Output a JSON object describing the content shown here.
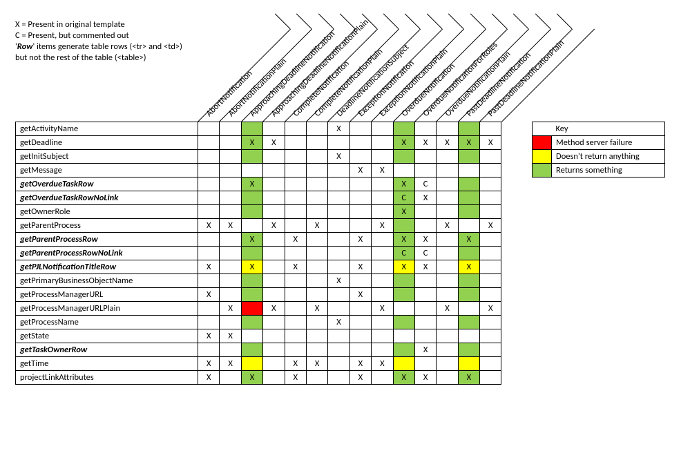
{
  "legend": {
    "line1": "X = Present in original template",
    "line2": "C = Present, but commented out",
    "line3a": "'",
    "line3b": "Row",
    "line3c": "' items generate table rows (<tr> and <td>) but not the rest of the table (<table>)"
  },
  "columns": [
    "AbortNotification",
    "AbortNotificationPlain",
    "ApproachingDeadlineNotification",
    "ApproachingDeadlineNotificationPlain",
    "CompleteNotification",
    "CompleteNotificationPlain",
    "DeadlineNotificationSubject",
    "ExceptionNotification",
    "ExceptionNotificationPlain",
    "OverdueNotification",
    "OverdueNotificationForRoles",
    "OverdueNotificationPlain",
    "PastDeadlineNotification",
    "PastDeadlineNotificationPlain"
  ],
  "rows": [
    {
      "label": "getActivityName",
      "bold": false,
      "cells": [
        "",
        "",
        "G",
        "",
        "",
        "",
        "X",
        "",
        "",
        "G",
        "",
        "",
        "G",
        ""
      ]
    },
    {
      "label": "getDeadline",
      "bold": false,
      "cells": [
        "",
        "",
        "GX",
        "X",
        "",
        "",
        "",
        "",
        "",
        "GX",
        "X",
        "X",
        "GX",
        "X"
      ]
    },
    {
      "label": "getInitSubject",
      "bold": false,
      "cells": [
        "",
        "",
        "G",
        "",
        "",
        "",
        "X",
        "",
        "",
        "G",
        "",
        "",
        "G",
        ""
      ]
    },
    {
      "label": "getMessage",
      "bold": false,
      "cells": [
        "",
        "",
        "",
        "",
        "",
        "",
        "",
        "X",
        "X",
        "",
        "",
        "",
        "",
        ""
      ]
    },
    {
      "label": "getOverdueTaskRow",
      "bold": true,
      "cells": [
        "",
        "",
        "GX",
        "",
        "",
        "",
        "",
        "",
        "",
        "GX",
        "C",
        "",
        "G",
        ""
      ]
    },
    {
      "label": "getOverdueTaskRowNoLink",
      "bold": true,
      "cells": [
        "",
        "",
        "G",
        "",
        "",
        "",
        "",
        "",
        "",
        "GC",
        "X",
        "",
        "G",
        ""
      ]
    },
    {
      "label": "getOwnerRole",
      "bold": false,
      "cells": [
        "",
        "",
        "G",
        "",
        "",
        "",
        "",
        "",
        "",
        "GX",
        "",
        "",
        "G",
        ""
      ]
    },
    {
      "label": "getParentProcess",
      "bold": false,
      "cells": [
        "X",
        "X",
        "",
        "X",
        "",
        "X",
        "",
        "",
        "X",
        "G",
        "",
        "X",
        "",
        "X"
      ]
    },
    {
      "label": "getParentProcessRow",
      "bold": true,
      "cells": [
        "",
        "",
        "GX",
        "",
        "X",
        "",
        "",
        "X",
        "",
        "GX",
        "X",
        "",
        "GX",
        ""
      ]
    },
    {
      "label": "getParentProcessRowNoLink",
      "bold": true,
      "cells": [
        "",
        "",
        "G",
        "",
        "",
        "",
        "",
        "",
        "",
        "GC",
        "C",
        "",
        "G",
        ""
      ]
    },
    {
      "label": "getPJLNotificationTitleRow",
      "bold": true,
      "cells": [
        "X",
        "",
        "YX",
        "",
        "X",
        "",
        "",
        "X",
        "",
        "YX",
        "X",
        "",
        "YX",
        ""
      ]
    },
    {
      "label": "getPrimaryBusinessObjectName",
      "bold": false,
      "cells": [
        "",
        "",
        "G",
        "",
        "",
        "",
        "X",
        "",
        "",
        "G",
        "",
        "",
        "G",
        ""
      ]
    },
    {
      "label": "getProcessManagerURL",
      "bold": false,
      "cells": [
        "X",
        "",
        "G",
        "",
        "",
        "",
        "",
        "X",
        "",
        "G",
        "",
        "",
        "G",
        ""
      ]
    },
    {
      "label": "getProcessManagerURLPlain",
      "bold": false,
      "cells": [
        "",
        "X",
        "R",
        "X",
        "",
        "X",
        "",
        "",
        "X",
        "",
        "",
        "X",
        "",
        "X"
      ]
    },
    {
      "label": "getProcessName",
      "bold": false,
      "cells": [
        "",
        "",
        "G",
        "",
        "",
        "",
        "X",
        "",
        "",
        "G",
        "",
        "",
        "G",
        ""
      ]
    },
    {
      "label": "getState",
      "bold": false,
      "cells": [
        "X",
        "X",
        "",
        "",
        "",
        "",
        "",
        "",
        "",
        "",
        "",
        "",
        "",
        ""
      ]
    },
    {
      "label": "getTaskOwnerRow",
      "bold": true,
      "cells": [
        "",
        "",
        "G",
        "",
        "",
        "",
        "",
        "",
        "",
        "G",
        "X",
        "",
        "G",
        ""
      ]
    },
    {
      "label": "getTime",
      "bold": false,
      "cells": [
        "X",
        "X",
        "Y",
        "",
        "X",
        "X",
        "",
        "X",
        "X",
        "Y",
        "",
        "",
        "Y",
        ""
      ]
    },
    {
      "label": "projectLinkAttributes",
      "bold": false,
      "cells": [
        "X",
        "",
        "GX",
        "",
        "X",
        "",
        "",
        "X",
        "",
        "GX",
        "X",
        "",
        "GX",
        ""
      ]
    }
  ],
  "key": {
    "title": "Key",
    "items": [
      {
        "color": "red",
        "label": "Method server failure"
      },
      {
        "color": "yellow",
        "label": "Doesn't return anything"
      },
      {
        "color": "green",
        "label": "Returns something"
      }
    ]
  },
  "chart_data": {
    "type": "table",
    "note": "Matrix of template-method calls vs notification types. Cell background color = method return behavior; text X/C = presence in template.",
    "columns": [
      "AbortNotification",
      "AbortNotificationPlain",
      "ApproachingDeadlineNotification",
      "ApproachingDeadlineNotificationPlain",
      "CompleteNotification",
      "CompleteNotificationPlain",
      "DeadlineNotificationSubject",
      "ExceptionNotification",
      "ExceptionNotificationPlain",
      "OverdueNotification",
      "OverdueNotificationForRoles",
      "OverdueNotificationPlain",
      "PastDeadlineNotification",
      "PastDeadlineNotificationPlain"
    ],
    "row_labels": [
      "getActivityName",
      "getDeadline",
      "getInitSubject",
      "getMessage",
      "getOverdueTaskRow",
      "getOverdueTaskRowNoLink",
      "getOwnerRole",
      "getParentProcess",
      "getParentProcessRow",
      "getParentProcessRowNoLink",
      "getPJLNotificationTitleRow",
      "getPrimaryBusinessObjectName",
      "getProcessManagerURL",
      "getProcessManagerURLPlain",
      "getProcessName",
      "getState",
      "getTaskOwnerRow",
      "getTime",
      "projectLinkAttributes"
    ],
    "color_legend": {
      "red": "Method server failure",
      "yellow": "Doesn't return anything",
      "green": "Returns something"
    },
    "mark_legend": {
      "X": "Present in original template",
      "C": "Present, but commented out"
    },
    "cells_encoding": "Each cell string may contain leading color letter G/Y/R followed by optional mark X or C; empty = blank white cell.",
    "cells": [
      [
        "",
        "",
        "G",
        "",
        "",
        "",
        "X",
        "",
        "",
        "G",
        "",
        "",
        "G",
        ""
      ],
      [
        "",
        "",
        "GX",
        "X",
        "",
        "",
        "",
        "",
        "",
        "GX",
        "X",
        "X",
        "GX",
        "X"
      ],
      [
        "",
        "",
        "G",
        "",
        "",
        "",
        "X",
        "",
        "",
        "G",
        "",
        "",
        "G",
        ""
      ],
      [
        "",
        "",
        "",
        "",
        "",
        "",
        "",
        "X",
        "X",
        "",
        "",
        "",
        "",
        ""
      ],
      [
        "",
        "",
        "GX",
        "",
        "",
        "",
        "",
        "",
        "",
        "GX",
        "C",
        "",
        "G",
        ""
      ],
      [
        "",
        "",
        "G",
        "",
        "",
        "",
        "",
        "",
        "",
        "GC",
        "X",
        "",
        "G",
        ""
      ],
      [
        "",
        "",
        "G",
        "",
        "",
        "",
        "",
        "",
        "",
        "GX",
        "",
        "",
        "G",
        ""
      ],
      [
        "X",
        "X",
        "",
        "X",
        "",
        "X",
        "",
        "",
        "X",
        "G",
        "",
        "X",
        "",
        "X"
      ],
      [
        "",
        "",
        "GX",
        "",
        "X",
        "",
        "",
        "X",
        "",
        "GX",
        "X",
        "",
        "GX",
        ""
      ],
      [
        "",
        "",
        "G",
        "",
        "",
        "",
        "",
        "",
        "",
        "GC",
        "C",
        "",
        "G",
        ""
      ],
      [
        "X",
        "",
        "YX",
        "",
        "X",
        "",
        "",
        "X",
        "",
        "YX",
        "X",
        "",
        "YX",
        ""
      ],
      [
        "",
        "",
        "G",
        "",
        "",
        "",
        "X",
        "",
        "",
        "G",
        "",
        "",
        "G",
        ""
      ],
      [
        "X",
        "",
        "G",
        "",
        "",
        "",
        "",
        "X",
        "",
        "G",
        "",
        "",
        "G",
        ""
      ],
      [
        "",
        "X",
        "R",
        "X",
        "",
        "X",
        "",
        "",
        "X",
        "",
        "",
        "X",
        "",
        "X"
      ],
      [
        "",
        "",
        "G",
        "",
        "",
        "",
        "X",
        "",
        "",
        "G",
        "",
        "",
        "G",
        ""
      ],
      [
        "X",
        "X",
        "",
        "",
        "",
        "",
        "",
        "",
        "",
        "",
        "",
        "",
        "",
        ""
      ],
      [
        "",
        "",
        "G",
        "",
        "",
        "",
        "",
        "",
        "",
        "G",
        "X",
        "",
        "G",
        ""
      ],
      [
        "X",
        "X",
        "Y",
        "",
        "X",
        "X",
        "",
        "X",
        "X",
        "Y",
        "",
        "",
        "Y",
        ""
      ],
      [
        "X",
        "",
        "GX",
        "",
        "X",
        "",
        "",
        "X",
        "",
        "GX",
        "X",
        "",
        "GX",
        ""
      ]
    ]
  }
}
